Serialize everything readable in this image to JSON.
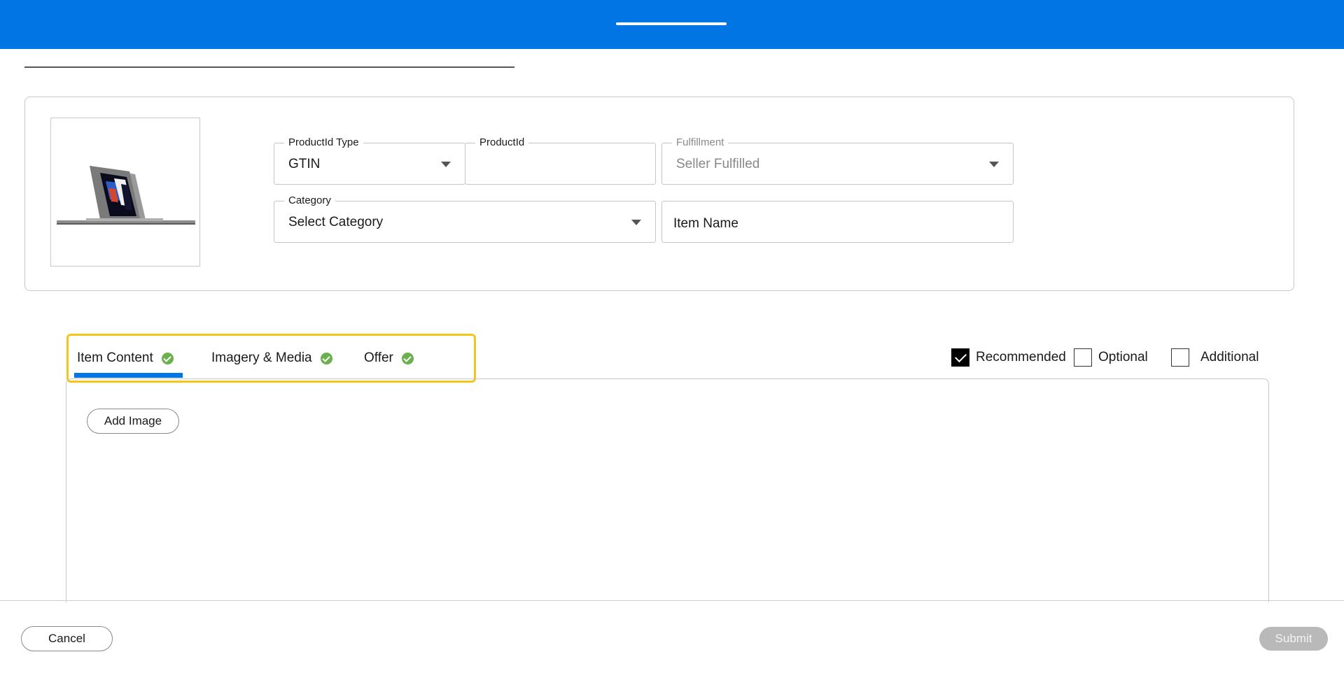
{
  "product": {
    "image_alt": "laptop",
    "fields": {
      "productid_type": {
        "label": "ProductId Type",
        "value": "GTIN"
      },
      "productid": {
        "label": "ProductId",
        "value": ""
      },
      "fulfillment": {
        "label": "Fulfillment",
        "value": "Seller Fulfilled"
      },
      "category": {
        "label": "Category",
        "value": "Select Category"
      },
      "item_name": {
        "placeholder": "Item Name"
      }
    }
  },
  "tabs": [
    {
      "label": "Item Content",
      "status": "complete",
      "active": true
    },
    {
      "label": "Imagery & Media",
      "status": "complete",
      "active": false
    },
    {
      "label": "Offer",
      "status": "complete",
      "active": false
    }
  ],
  "filters": [
    {
      "label": "Recommended",
      "checked": true
    },
    {
      "label": "Optional",
      "checked": false
    },
    {
      "label": "Additional",
      "checked": false
    }
  ],
  "content": {
    "add_image_label": "Add Image"
  },
  "footer": {
    "cancel_label": "Cancel",
    "submit_label": "Submit"
  },
  "colors": {
    "primary": "#0075e3",
    "success": "#6ab04c",
    "highlight": "#f5c518",
    "disabled": "#b9b9b9"
  }
}
